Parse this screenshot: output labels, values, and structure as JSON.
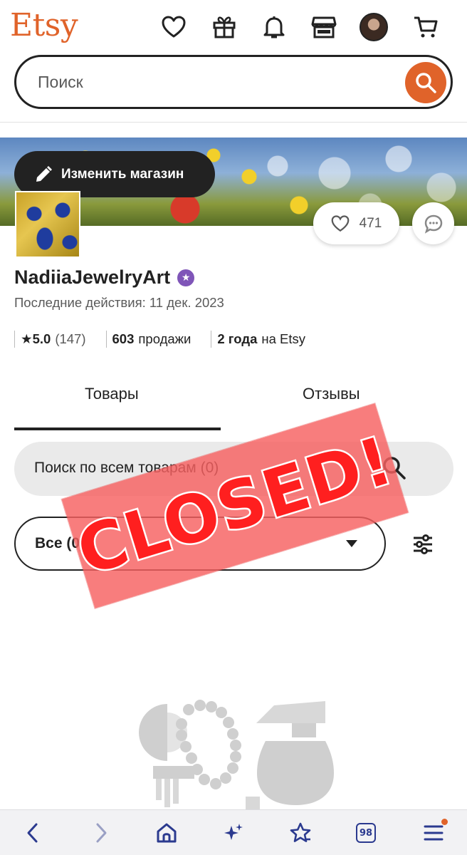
{
  "header": {
    "logo": "Etsy",
    "icons": [
      "heart-icon",
      "gift-icon",
      "bell-icon",
      "shop-icon",
      "avatar",
      "cart-icon"
    ],
    "search_placeholder": "Поиск"
  },
  "shop": {
    "edit_label": "Изменить магазин",
    "favorites_count": "471",
    "name": "NadiiaJewelryArt",
    "last_active": "Последние действия: 11 дек. 2023",
    "rating": "★5.0",
    "reviews_count": "(147)",
    "sales_number": "603",
    "sales_label": "продажи",
    "years_number": "2 года",
    "years_suffix": "на Etsy"
  },
  "tabs": [
    {
      "label": "Товары",
      "active": true
    },
    {
      "label": "Отзывы",
      "active": false
    }
  ],
  "shop_search": {
    "placeholder": "Поиск по всем товарам (0)"
  },
  "filter": {
    "selected": "Все (0)"
  },
  "overlay": {
    "stamp_text": "CLOSED!"
  },
  "browser_bar": {
    "tabs_count": "98",
    "icons": [
      "back-icon",
      "forward-icon",
      "home-icon",
      "sparkle-icon",
      "favorites-icon",
      "tabs-icon",
      "menu-icon"
    ]
  },
  "colors": {
    "brand": "#e0632a",
    "star_seller": "#7f55b8",
    "stamp": "#f66060",
    "browser_accent": "#2b3a8f"
  }
}
